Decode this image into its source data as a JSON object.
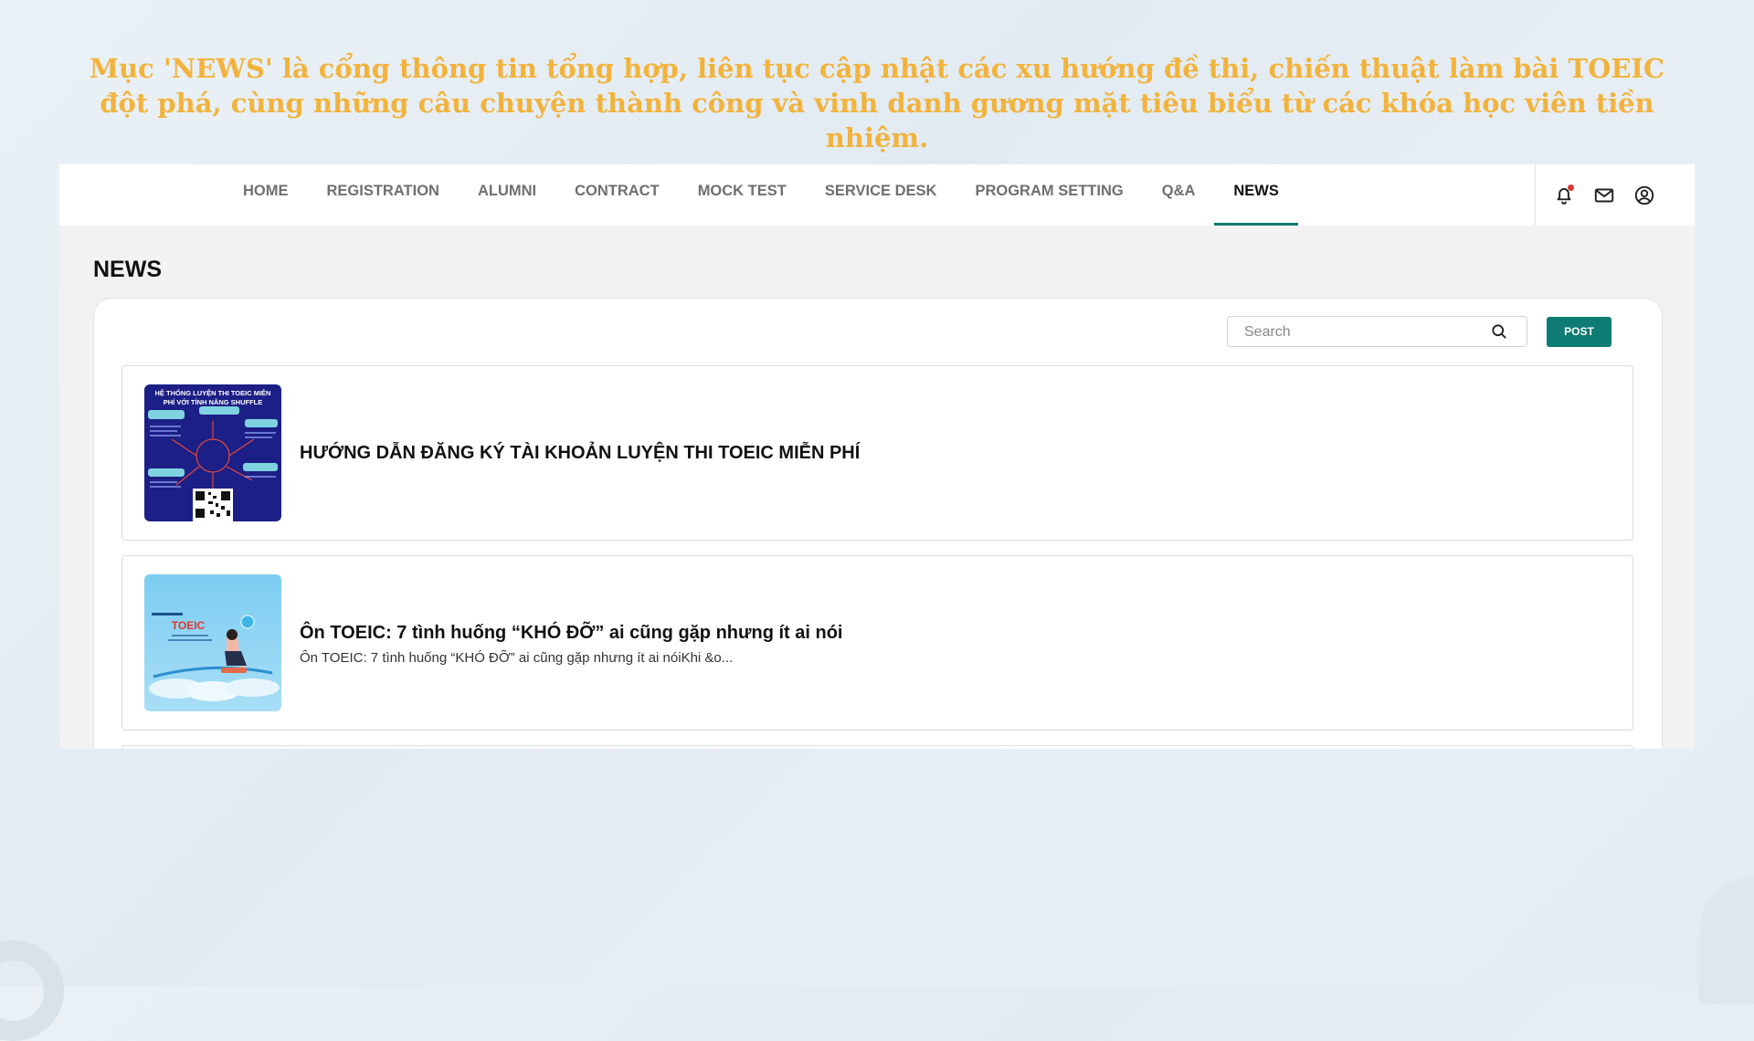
{
  "caption": "Mục 'NEWS' là cổng thông tin tổng hợp, liên tục cập nhật các xu hướng đề thi, chiến thuật làm bài TOEIC đột phá, cùng những câu chuyện thành công và vinh danh gương mặt tiêu biểu từ các khóa học viên tiền nhiệm.",
  "nav": {
    "items": [
      {
        "label": "HOME"
      },
      {
        "label": "REGISTRATION"
      },
      {
        "label": "ALUMNI"
      },
      {
        "label": "CONTRACT"
      },
      {
        "label": "MOCK TEST"
      },
      {
        "label": "SERVICE DESK"
      },
      {
        "label": "PROGRAM SETTING"
      },
      {
        "label": "Q&A"
      },
      {
        "label": "NEWS"
      }
    ],
    "active": "NEWS",
    "icons": [
      "bell-icon",
      "mail-icon",
      "user-circle-icon"
    ],
    "accent_color": "#0e7c72",
    "notification_dot_color": "#e0363c"
  },
  "page": {
    "title": "NEWS",
    "search_placeholder": "Search",
    "post_label": "POST"
  },
  "news": [
    {
      "title": "HƯỚNG DẪN ĐĂNG KÝ TÀI KHOẢN LUYỆN THI TOEIC MIỄN PHÍ",
      "excerpt": "",
      "thumb_title": "HỆ THỐNG LUYỆN THI TOEIC MIỄN PHÍ VỚI TÍNH NĂNG SHUFFLE"
    },
    {
      "title": "Ôn TOEIC: 7 tình huống “KHÓ ĐỠ” ai cũng gặp nhưng ít ai nói",
      "excerpt": "Ôn TOEIC: 7 tình huống “KHÓ ĐỠ” ai cũng gặp nhưng ít ai nóiKhi &o...",
      "thumb_title": "TOEIC"
    }
  ]
}
